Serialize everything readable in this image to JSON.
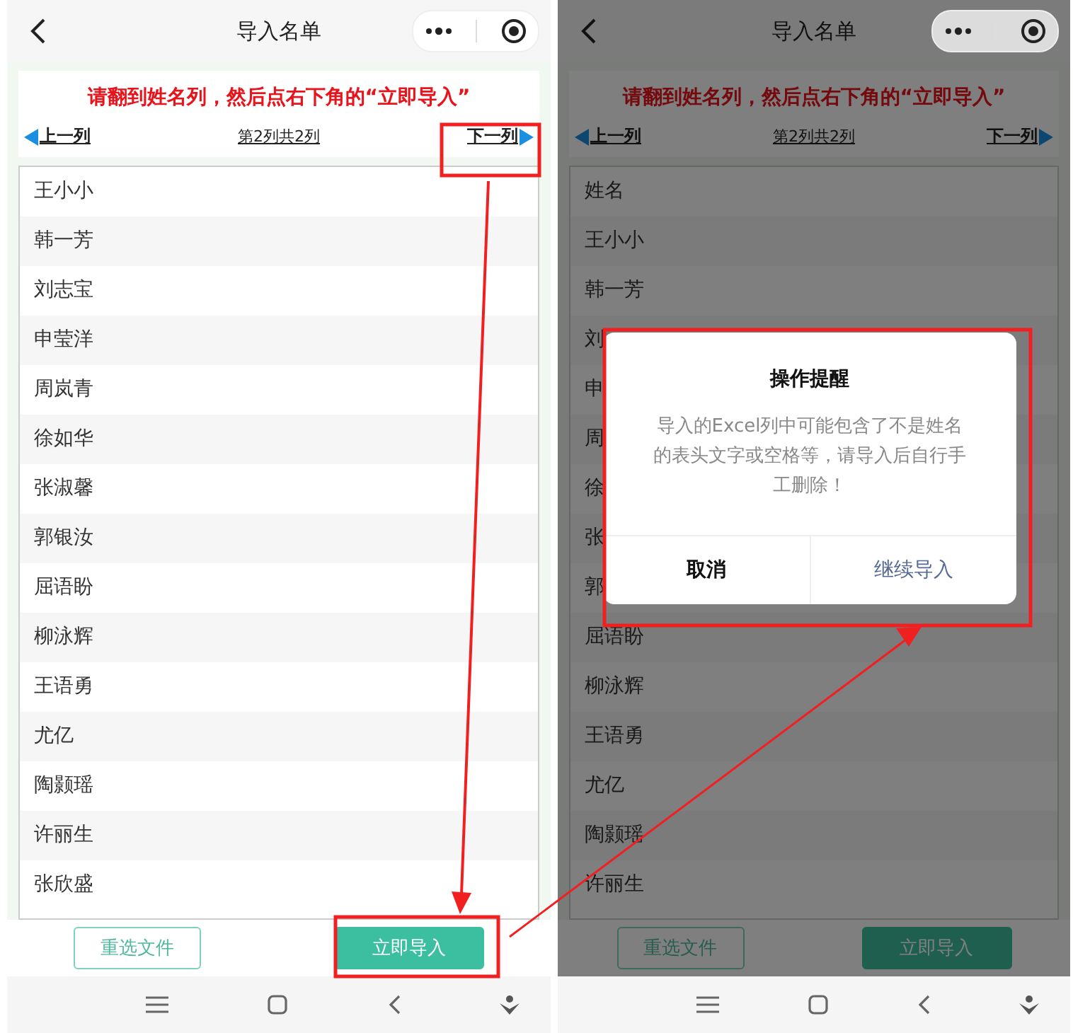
{
  "screens": [
    {
      "title": "导入名单",
      "hint": "请翻到姓名列，然后点右下角的“立即导入”",
      "prev_label": "上一列",
      "page_label": "第2列共2列",
      "next_label": "下一列",
      "dimmed": false,
      "rows": [
        "王小小",
        "韩一芳",
        "刘志宝",
        "申莹洋",
        "周岚青",
        "徐如华",
        "张淑馨",
        "郭银汝",
        "屈语盼",
        "柳泳辉",
        "王语勇",
        "尤亿",
        "陶颢瑶",
        "许丽生",
        "张欣盛"
      ],
      "buttons": [
        {
          "label": "重选文件",
          "kind": "outline"
        },
        {
          "label": "立即导入",
          "kind": "primary"
        }
      ]
    },
    {
      "title": "导入名单",
      "hint": "请翻到姓名列，然后点右下角的“立即导入”",
      "prev_label": "上一列",
      "page_label": "第2列共2列",
      "next_label": "下一列",
      "dimmed": true,
      "rows": [
        "姓名",
        "王小小",
        "韩一芳",
        "刘",
        "申",
        "周",
        "徐",
        "张",
        "郭",
        "屈语盼",
        "柳泳辉",
        "王语勇",
        "尤亿",
        "陶颢瑶",
        "许丽生"
      ],
      "buttons": [
        {
          "label": "重选文件",
          "kind": "outline"
        },
        {
          "label": "立即导入",
          "kind": "primary"
        }
      ],
      "dialog": {
        "title": "操作提醒",
        "message": "导入的Excel列中可能包含了不是姓名的表头文字或空格等，请导入后自行手工删除！",
        "buttons": [
          {
            "label": "取消",
            "kind": "cancel"
          },
          {
            "label": "继续导入",
            "kind": "confirm"
          }
        ]
      }
    }
  ]
}
